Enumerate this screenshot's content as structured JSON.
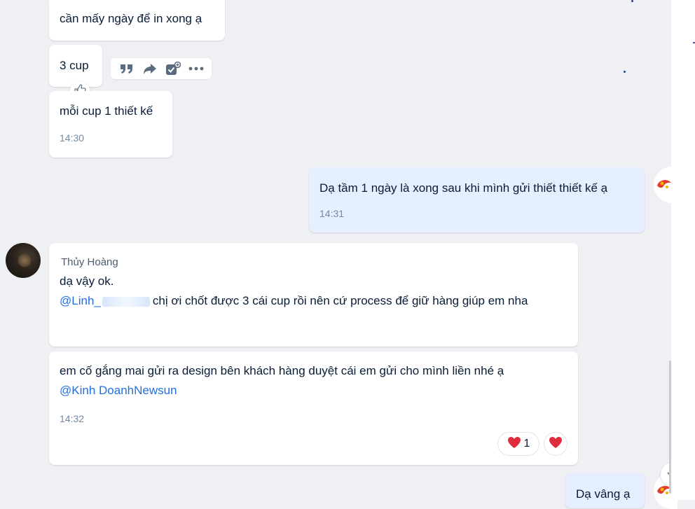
{
  "messages": {
    "m1": {
      "text": "cần mấy ngày để in xong ạ"
    },
    "m2": {
      "text": "3 cup"
    },
    "m3": {
      "text": "mỗi cup 1 thiết kế",
      "time": "14:30"
    },
    "m4": {
      "text": "Dạ tầm 1 ngày là xong sau khi mình gửi thiết thiết kế ạ",
      "time": "14:31"
    },
    "m5": {
      "sender": "Thủy Hoàng",
      "line1": "dạ vậy ok.",
      "mention": "@Linh_",
      "rest": "chị ơi chốt được 3 cái cup rồi nên cứ process để giữ hàng giúp em nha"
    },
    "m6": {
      "text": "em cố gắng mai gửi ra design bên khách hàng duyệt cái em gửi cho mình liền nhé ạ",
      "mention": "@Kinh DoanhNewsun",
      "time": "14:32",
      "reaction_count": "1"
    },
    "m7": {
      "text": "Dạ vâng ạ"
    }
  },
  "icons": {
    "quote": "quote-icon",
    "share": "share-icon",
    "task": "add-task-icon",
    "more": "more-icon",
    "like": "thumbs-up-icon",
    "heart": "heart-icon"
  },
  "colors": {
    "background": "#eef0f3",
    "bubble": "#ffffff",
    "my_bubble": "#e5efff",
    "mention": "#1f6fe0",
    "heart": "#e02d3c"
  }
}
